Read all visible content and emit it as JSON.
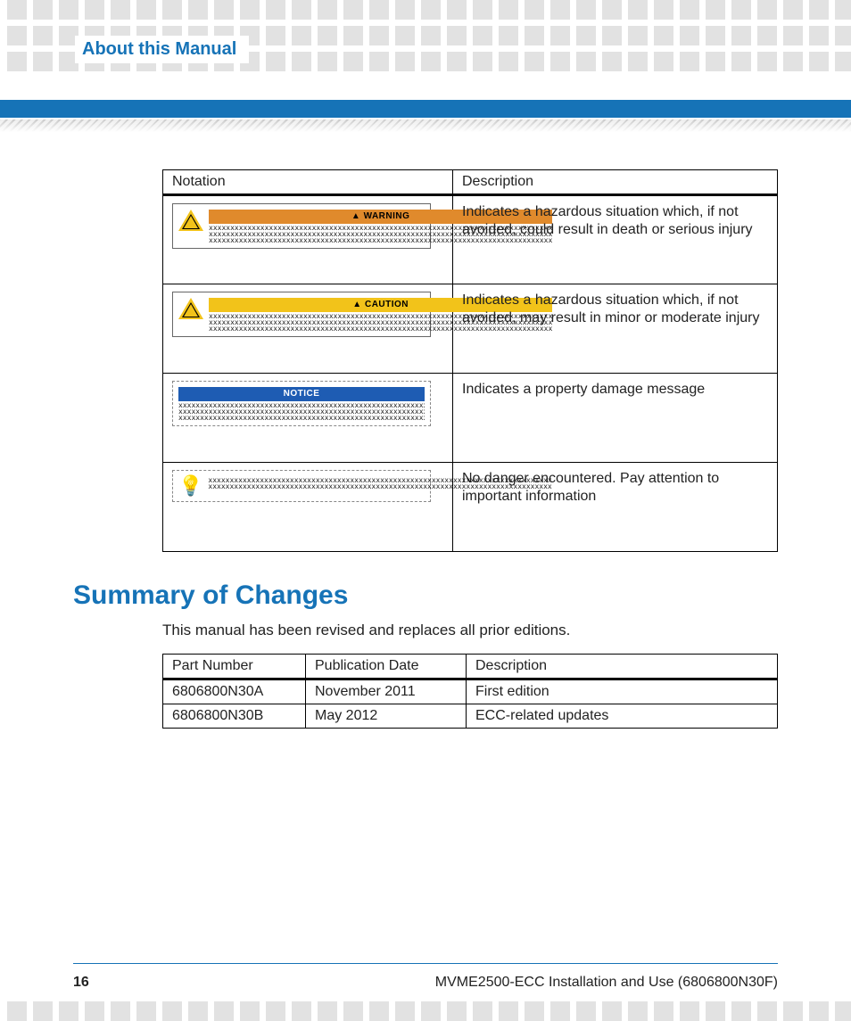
{
  "header": {
    "title": "About this Manual"
  },
  "notation_table": {
    "headers": [
      "Notation",
      "Description"
    ],
    "rows": [
      {
        "sample_type": "warning",
        "sample_label": "WARNING",
        "desc": "Indicates a hazardous situation which, if not avoided, could result in death or serious injury"
      },
      {
        "sample_type": "caution",
        "sample_label": "CAUTION",
        "desc": "Indicates a hazardous situation which, if not avoided, may result in minor or moderate injury"
      },
      {
        "sample_type": "notice",
        "sample_label": "NOTICE",
        "desc": "Indicates a property damage message"
      },
      {
        "sample_type": "info",
        "sample_label": "",
        "desc": "No danger encountered. Pay attention to important information"
      }
    ],
    "placeholder_line": "xxxxxxxxxxxxxxxxxxxxxxxxxxxxxxxxxxxxxxxxxxxxxxxxxxxxxxxxxxxxxxxxxxxxxxxxxxxxxxxx"
  },
  "changes": {
    "heading": "Summary of Changes",
    "intro": "This manual has been revised and replaces all prior editions.",
    "headers": [
      "Part Number",
      "Publication Date",
      "Description"
    ],
    "rows": [
      {
        "part": "6806800N30A",
        "date": "November 2011",
        "desc": "First edition"
      },
      {
        "part": "6806800N30B",
        "date": "May 2012",
        "desc": "ECC-related updates"
      }
    ]
  },
  "footer": {
    "page": "16",
    "doc": "MVME2500-ECC Installation and Use (6806800N30F)"
  }
}
